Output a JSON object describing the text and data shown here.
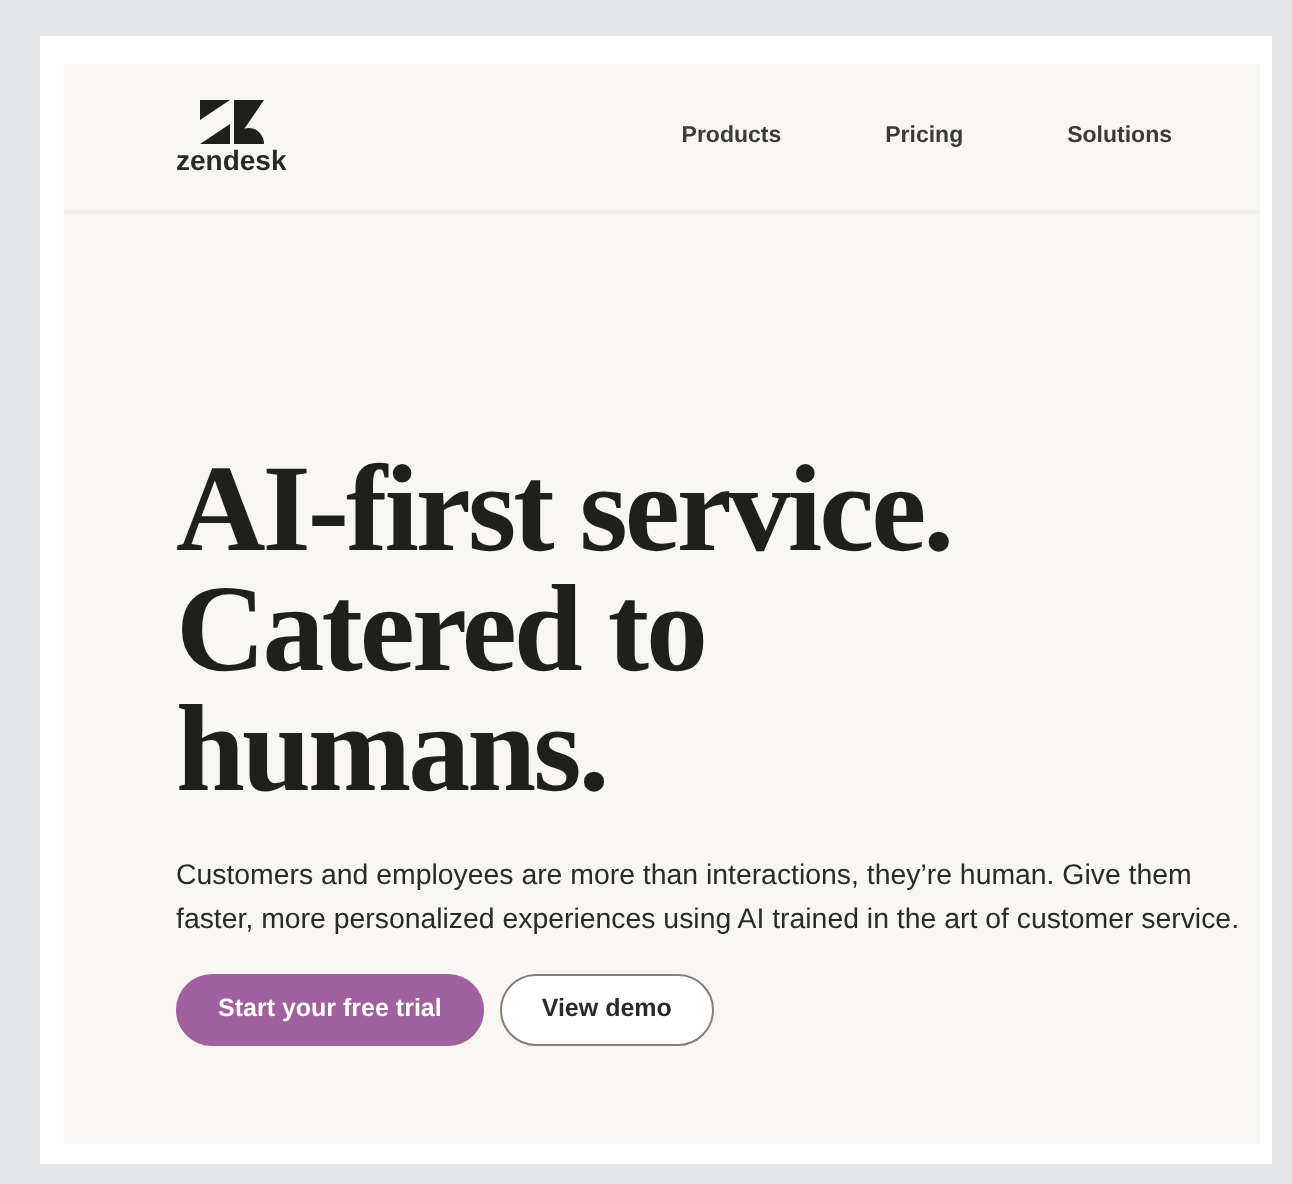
{
  "logo": {
    "text": "zendesk"
  },
  "nav": [
    {
      "label": "Products"
    },
    {
      "label": "Pricing"
    },
    {
      "label": "Solutions"
    }
  ],
  "hero": {
    "headline": [
      "AI-first service.",
      "Catered to",
      "humans."
    ],
    "text": "Customers and employees are more than interactions, they’re human. Give them faster, more personalized experiences using AI trained in the art of customer service.",
    "buttons": [
      {
        "label": "Start your free trial",
        "kind": "primary"
      },
      {
        "label": "View demo",
        "kind": "outline"
      }
    ]
  }
}
